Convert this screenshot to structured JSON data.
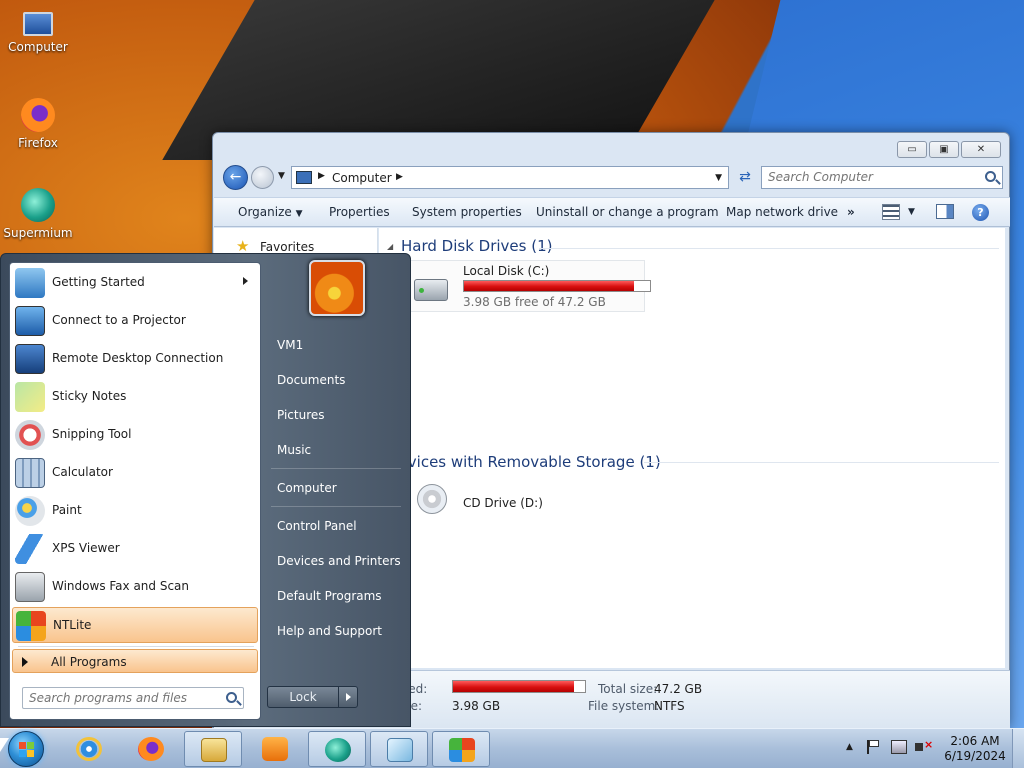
{
  "desktop": {
    "icons": [
      {
        "label": "Computer"
      },
      {
        "label": "Firefox"
      },
      {
        "label": "Supermium"
      }
    ]
  },
  "explorer": {
    "caption_buttons": {
      "minimize": "▭",
      "maximize": "▣",
      "close": "✕"
    },
    "address": {
      "crumb": "Computer"
    },
    "search": {
      "placeholder": "Search Computer"
    },
    "toolbar": {
      "organize": "Organize",
      "properties": "Properties",
      "system_properties": "System properties",
      "uninstall": "Uninstall or change a program",
      "map_drive": "Map network drive",
      "more": "»"
    },
    "nav": {
      "favorites": "Favorites"
    },
    "groups": {
      "hdd": "Hard Disk Drives (1)",
      "removable": "Devices with Removable Storage (1)"
    },
    "drives": {
      "c": {
        "name": "Local Disk (C:)",
        "free_text": "3.98 GB free of 47.2 GB",
        "used_fraction": 0.916
      },
      "d": {
        "name": "CD Drive (D:)"
      }
    },
    "details": {
      "space_used_label": "Space used:",
      "space_free_label": "Space free:",
      "space_free_value": "3.98 GB",
      "total_size_label": "Total size:",
      "total_size_value": "47.2 GB",
      "file_system_label": "File system:",
      "file_system_value": "NTFS"
    }
  },
  "start_menu": {
    "programs": [
      {
        "label": "Getting Started",
        "has_submenu": true
      },
      {
        "label": "Connect to a Projector"
      },
      {
        "label": "Remote Desktop Connection"
      },
      {
        "label": "Sticky Notes"
      },
      {
        "label": "Snipping Tool"
      },
      {
        "label": "Calculator"
      },
      {
        "label": "Paint"
      },
      {
        "label": "XPS Viewer"
      },
      {
        "label": "Windows Fax and Scan"
      },
      {
        "label": "NTLite"
      }
    ],
    "all_programs": "All Programs",
    "search_placeholder": "Search programs and files",
    "right_items": [
      {
        "label": "VM1"
      },
      {
        "label": "Documents"
      },
      {
        "label": "Pictures"
      },
      {
        "label": "Music"
      },
      {
        "label": "Computer"
      },
      {
        "label": "Control Panel"
      },
      {
        "label": "Devices and Printers"
      },
      {
        "label": "Default Programs"
      },
      {
        "label": "Help and Support"
      }
    ],
    "lock_label": "Lock"
  },
  "taskbar": {
    "clock_time": "2:06 AM",
    "clock_date": "6/19/2024"
  },
  "colors": {
    "accent_blue": "#2f73c9",
    "highlight_orange": "#f9c48d",
    "drive_bar_red": "#d80f0f"
  }
}
